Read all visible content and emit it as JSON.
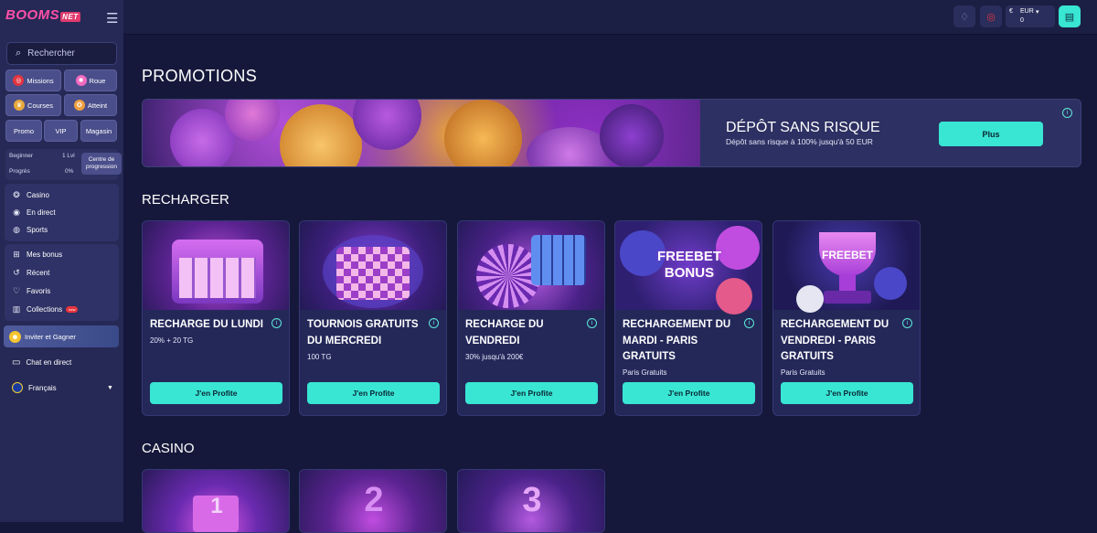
{
  "brand": {
    "logo": "BOOMS",
    "logo_suffix": "NET"
  },
  "search": {
    "placeholder": "Rechercher"
  },
  "quick_links": {
    "missions": "Missions",
    "roue": "Roue",
    "courses": "Courses",
    "atteint": "Atteint",
    "promo": "Promo",
    "vip": "VIP",
    "magasin": "Magasin"
  },
  "level": {
    "name": "Beginner",
    "lvl": "1 Lvl",
    "progress_label": "Progrès",
    "progress_value": "0%",
    "progress_button": "Centre de progression"
  },
  "nav_main": [
    "Casino",
    "En direct",
    "Sports"
  ],
  "nav_user": {
    "bonus": "Mes bonus",
    "recent": "Récent",
    "favoris": "Favoris",
    "collections": "Collections",
    "collections_badge": "new"
  },
  "invite": "Inviter et Gagner",
  "chat": "Chat en direct",
  "language": "Français",
  "wallet": {
    "currency_symbol": "€",
    "currency": "EUR",
    "balance": "0"
  },
  "sections": {
    "promotions": "PROMOTIONS",
    "recharger": "RECHARGER",
    "casino": "CASINO"
  },
  "banner": {
    "title": "DÉPÔT SANS RISQUE",
    "subtitle": "Dépôt sans risque à 100% jusqu'à 50 EUR",
    "button": "Plus"
  },
  "recharge_cards": [
    {
      "title": "RECHARGE DU LUNDI",
      "subtitle": "20% + 20 TG",
      "button": "J'en Profite"
    },
    {
      "title": "TOURNOIS GRATUITS DU MERCREDI",
      "subtitle": "100 TG",
      "button": "J'en Profite"
    },
    {
      "title": "RECHARGE DU VENDREDI",
      "subtitle": "30% jusqu'à 200€",
      "button": "J'en Profite"
    },
    {
      "title": "RECHARGEMENT DU MARDI - PARIS GRATUITS",
      "subtitle": "Paris Gratuits",
      "button": "J'en Profite",
      "art_text_1": "FREEBET",
      "art_text_2": "BONUS"
    },
    {
      "title": "RECHARGEMENT DU VENDREDI - PARIS GRATUITS",
      "subtitle": "Paris Gratuits",
      "button": "J'en Profite",
      "art_text_1": "FREEBET"
    }
  ],
  "casino_art": [
    "1",
    "2",
    "3"
  ],
  "colors": {
    "accent": "#38e6d3",
    "bg": "#16183b",
    "sidebar": "#262955",
    "card": "#242859"
  }
}
